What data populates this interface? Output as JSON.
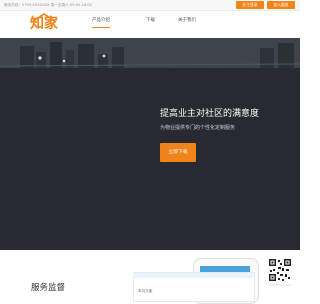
{
  "topbar": {
    "info": "服务热线：0799-XXXXXXX   周一至周六  09:00-18:00",
    "login_label": "业主登录",
    "join_label": "加入服务"
  },
  "header": {
    "logo_text": "知家",
    "nav": [
      {
        "label": "产品介绍"
      },
      {
        "label": "下载"
      },
      {
        "label": "关于我们"
      }
    ]
  },
  "hero": {
    "title": "提高业主对社区的满意度",
    "subtitle": "为物业提供专门的个性化定制服务",
    "cta_label": "立即下载"
  },
  "section": {
    "title": "服务监督"
  },
  "card": {
    "label": "本月万能"
  },
  "colors": {
    "accent": "#f0841a",
    "hero_dark": "#272a30",
    "hero_top": "#3b4148",
    "phone_blue": "#4aa3df"
  }
}
